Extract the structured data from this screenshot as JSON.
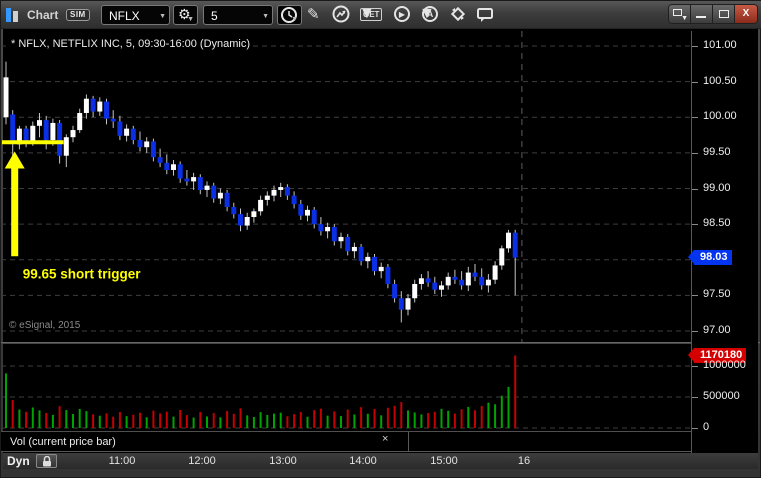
{
  "window": {
    "title": "Chart",
    "mode_badge": "SIM",
    "controls": [
      {
        "name": "dock-window"
      },
      {
        "name": "minimize"
      },
      {
        "name": "maximize"
      },
      {
        "name": "close"
      }
    ]
  },
  "toolbar": {
    "symbol_combo": {
      "value": "NFLX"
    },
    "interval_combo": {
      "value": "5"
    },
    "get_label": "GET",
    "auto_label": "A",
    "icons": [
      "symbol-settings-gear-icon",
      "time-template-clock-icon",
      "draw-pencil-icon",
      "trendline-tool-icon",
      "get-data-icon",
      "replay-play-icon",
      "auto-analysis-icon",
      "symbol-link-icon",
      "text-note-icon"
    ]
  },
  "chart": {
    "legend": "* NFLX, NETFLIX INC, 5, 09:30-16:00 (Dynamic)",
    "watermark": "© eSignal, 2015"
  },
  "price_axis": {
    "ticks": [
      {
        "label": "101.00",
        "value": 101.0
      },
      {
        "label": "100.50",
        "value": 100.5
      },
      {
        "label": "100.00",
        "value": 100.0
      },
      {
        "label": "99.50",
        "value": 99.5
      },
      {
        "label": "99.00",
        "value": 99.0
      },
      {
        "label": "98.50",
        "value": 98.5
      },
      {
        "label": "97.50",
        "value": 97.5
      },
      {
        "label": "97.00",
        "value": 97.0
      }
    ],
    "last_price": {
      "label": "98.03",
      "value": 98.03
    }
  },
  "volume_axis": {
    "ticks": [
      {
        "label": "1000000",
        "value": 1000000
      },
      {
        "label": "500000",
        "value": 500000
      },
      {
        "label": "0",
        "value": 0
      }
    ],
    "last_volume": {
      "label": "1170180",
      "value": 1170180
    }
  },
  "indicator_tab": {
    "label": "Vol (current price bar)",
    "close_glyph": "×"
  },
  "bottom_bar": {
    "mode_label": "Dyn",
    "time_labels": [
      {
        "label": "11:00",
        "bar": 17
      },
      {
        "label": "12:00",
        "bar": 29
      },
      {
        "label": "13:00",
        "bar": 41
      },
      {
        "label": "14:00",
        "bar": 53
      },
      {
        "label": "15:00",
        "bar": 65
      },
      {
        "label": "16",
        "bar": 77
      }
    ]
  },
  "chart_data": {
    "type": "candlestick",
    "symbol": "NFLX",
    "company": "NETFLIX INC",
    "interval_minutes": 5,
    "session": "09:30-16:00",
    "title": "* NFLX, NETFLIX INC, 5, 09:30-16:00 (Dynamic)",
    "price_range": [
      97.0,
      101.0
    ],
    "grid_step": 0.5,
    "volume_range": [
      0,
      1000000
    ],
    "last_price": 98.03,
    "last_volume": 1170180,
    "colors": {
      "up_body": "#ffffff",
      "down_body": "#0a2fe4",
      "wick": "#c4c4c4",
      "vol_up": "#00a400",
      "vol_down": "#c40000",
      "grid": "#3e3e3e",
      "session_line": "#5d5d5d",
      "annotation": "#ffff00",
      "price_flag": "#0334f0",
      "volume_flag": "#d40000"
    },
    "annotation": {
      "text": "99.65 short trigger",
      "line": {
        "price": 99.65,
        "from_bar": 0,
        "to_bar": 8
      },
      "arrow": {
        "bar": 1,
        "from_price": 98.05,
        "to_price": 99.52
      },
      "text_pos": {
        "bar": 2.5,
        "price": 97.74
      }
    },
    "bars": [
      [
        "09:35",
        100.0,
        100.78,
        99.9,
        100.56,
        880000
      ],
      [
        "09:40",
        100.04,
        100.1,
        99.45,
        99.62,
        452000
      ],
      [
        "09:45",
        99.62,
        99.88,
        99.55,
        99.84,
        298000
      ],
      [
        "09:50",
        99.84,
        99.88,
        99.58,
        99.64,
        262000
      ],
      [
        "09:55",
        99.64,
        99.94,
        99.6,
        99.88,
        331000
      ],
      [
        "10:00",
        99.88,
        100.06,
        99.72,
        99.96,
        284000
      ],
      [
        "10:05",
        99.96,
        100.02,
        99.55,
        99.68,
        243000
      ],
      [
        "10:10",
        99.68,
        99.98,
        99.6,
        99.92,
        212000
      ],
      [
        "10:15",
        99.92,
        99.96,
        99.35,
        99.46,
        352000
      ],
      [
        "10:20",
        99.46,
        99.76,
        99.3,
        99.72,
        289000
      ],
      [
        "10:25",
        99.72,
        99.88,
        99.65,
        99.82,
        226000
      ],
      [
        "10:30",
        99.82,
        100.12,
        99.78,
        100.06,
        308000
      ],
      [
        "10:35",
        100.06,
        100.32,
        99.98,
        100.26,
        272000
      ],
      [
        "10:40",
        100.26,
        100.3,
        100.0,
        100.08,
        221000
      ],
      [
        "10:45",
        100.08,
        100.28,
        100.02,
        100.22,
        198000
      ],
      [
        "10:50",
        100.22,
        100.26,
        99.9,
        99.98,
        237000
      ],
      [
        "10:55",
        99.98,
        100.1,
        99.85,
        99.94,
        182000
      ],
      [
        "11:00",
        99.94,
        100.02,
        99.68,
        99.74,
        258000
      ],
      [
        "11:05",
        99.74,
        99.9,
        99.66,
        99.84,
        191000
      ],
      [
        "11:10",
        99.84,
        99.88,
        99.62,
        99.68,
        214000
      ],
      [
        "11:15",
        99.68,
        99.8,
        99.52,
        99.58,
        246000
      ],
      [
        "11:20",
        99.58,
        99.72,
        99.5,
        99.66,
        173000
      ],
      [
        "11:25",
        99.66,
        99.7,
        99.38,
        99.44,
        281000
      ],
      [
        "11:30",
        99.44,
        99.56,
        99.3,
        99.36,
        235000
      ],
      [
        "11:35",
        99.36,
        99.48,
        99.2,
        99.26,
        263000
      ],
      [
        "11:40",
        99.26,
        99.4,
        99.18,
        99.34,
        184000
      ],
      [
        "11:45",
        99.34,
        99.38,
        99.08,
        99.14,
        291000
      ],
      [
        "11:50",
        99.14,
        99.26,
        99.04,
        99.1,
        208000
      ],
      [
        "11:55",
        99.1,
        99.22,
        98.98,
        99.16,
        169000
      ],
      [
        "12:00",
        99.16,
        99.2,
        98.92,
        98.98,
        257000
      ],
      [
        "12:05",
        98.98,
        99.1,
        98.88,
        99.04,
        186000
      ],
      [
        "12:10",
        99.04,
        99.08,
        98.8,
        98.86,
        241000
      ],
      [
        "12:15",
        98.86,
        99.0,
        98.78,
        98.94,
        172000
      ],
      [
        "12:20",
        98.94,
        98.98,
        98.68,
        98.74,
        276000
      ],
      [
        "12:25",
        98.74,
        98.8,
        98.58,
        98.64,
        228000
      ],
      [
        "12:30",
        98.64,
        98.72,
        98.4,
        98.48,
        317000
      ],
      [
        "12:35",
        98.48,
        98.66,
        98.42,
        98.6,
        203000
      ],
      [
        "12:40",
        98.6,
        98.72,
        98.52,
        98.68,
        178000
      ],
      [
        "12:45",
        98.68,
        98.9,
        98.62,
        98.84,
        256000
      ],
      [
        "12:50",
        98.84,
        98.96,
        98.76,
        98.9,
        211000
      ],
      [
        "12:55",
        98.9,
        99.04,
        98.82,
        98.98,
        232000
      ],
      [
        "13:00",
        98.98,
        99.08,
        98.88,
        99.02,
        247000
      ],
      [
        "13:05",
        99.02,
        99.06,
        98.84,
        98.9,
        189000
      ],
      [
        "13:10",
        98.9,
        98.96,
        98.72,
        98.78,
        223000
      ],
      [
        "13:15",
        98.78,
        98.84,
        98.56,
        98.62,
        259000
      ],
      [
        "13:20",
        98.62,
        98.76,
        98.54,
        98.7,
        181000
      ],
      [
        "13:25",
        98.7,
        98.74,
        98.44,
        98.5,
        288000
      ],
      [
        "13:30",
        98.5,
        98.6,
        98.34,
        98.4,
        312000
      ],
      [
        "13:35",
        98.4,
        98.52,
        98.3,
        98.46,
        199000
      ],
      [
        "13:40",
        98.46,
        98.5,
        98.2,
        98.26,
        268000
      ],
      [
        "13:45",
        98.26,
        98.38,
        98.16,
        98.32,
        192000
      ],
      [
        "13:50",
        98.32,
        98.36,
        98.06,
        98.12,
        297000
      ],
      [
        "13:55",
        98.12,
        98.24,
        98.02,
        98.18,
        218000
      ],
      [
        "14:00",
        98.18,
        98.22,
        97.92,
        97.98,
        336000
      ],
      [
        "14:05",
        97.98,
        98.1,
        97.88,
        98.04,
        229000
      ],
      [
        "14:10",
        98.04,
        98.08,
        97.78,
        97.84,
        308000
      ],
      [
        "14:15",
        97.84,
        97.96,
        97.74,
        97.9,
        204000
      ],
      [
        "14:20",
        97.9,
        97.94,
        97.6,
        97.66,
        327000
      ],
      [
        "14:25",
        97.66,
        97.72,
        97.4,
        97.46,
        358000
      ],
      [
        "14:30",
        97.46,
        97.56,
        97.12,
        97.3,
        417000
      ],
      [
        "14:35",
        97.3,
        97.52,
        97.22,
        97.46,
        283000
      ],
      [
        "14:40",
        97.46,
        97.72,
        97.4,
        97.66,
        251000
      ],
      [
        "14:45",
        97.66,
        97.8,
        97.58,
        97.74,
        219000
      ],
      [
        "14:50",
        97.74,
        97.84,
        97.62,
        97.68,
        242000
      ],
      [
        "14:55",
        97.68,
        97.76,
        97.52,
        97.58,
        261000
      ],
      [
        "15:00",
        97.58,
        97.7,
        97.48,
        97.64,
        309000
      ],
      [
        "15:05",
        97.64,
        97.82,
        97.58,
        97.76,
        278000
      ],
      [
        "15:10",
        97.76,
        97.86,
        97.66,
        97.72,
        233000
      ],
      [
        "15:15",
        97.72,
        97.84,
        97.58,
        97.64,
        302000
      ],
      [
        "15:20",
        97.64,
        97.9,
        97.56,
        97.82,
        341000
      ],
      [
        "15:25",
        97.82,
        97.94,
        97.7,
        97.76,
        287000
      ],
      [
        "15:30",
        97.76,
        97.88,
        97.58,
        97.64,
        356000
      ],
      [
        "15:35",
        97.64,
        97.8,
        97.54,
        97.72,
        408000
      ],
      [
        "15:40",
        97.72,
        97.98,
        97.66,
        97.92,
        382000
      ],
      [
        "15:45",
        97.92,
        98.2,
        97.86,
        98.16,
        521000
      ],
      [
        "15:50",
        98.16,
        98.42,
        98.1,
        98.38,
        663000
      ],
      [
        "15:55",
        98.38,
        98.42,
        97.5,
        98.03,
        1170180
      ]
    ]
  }
}
